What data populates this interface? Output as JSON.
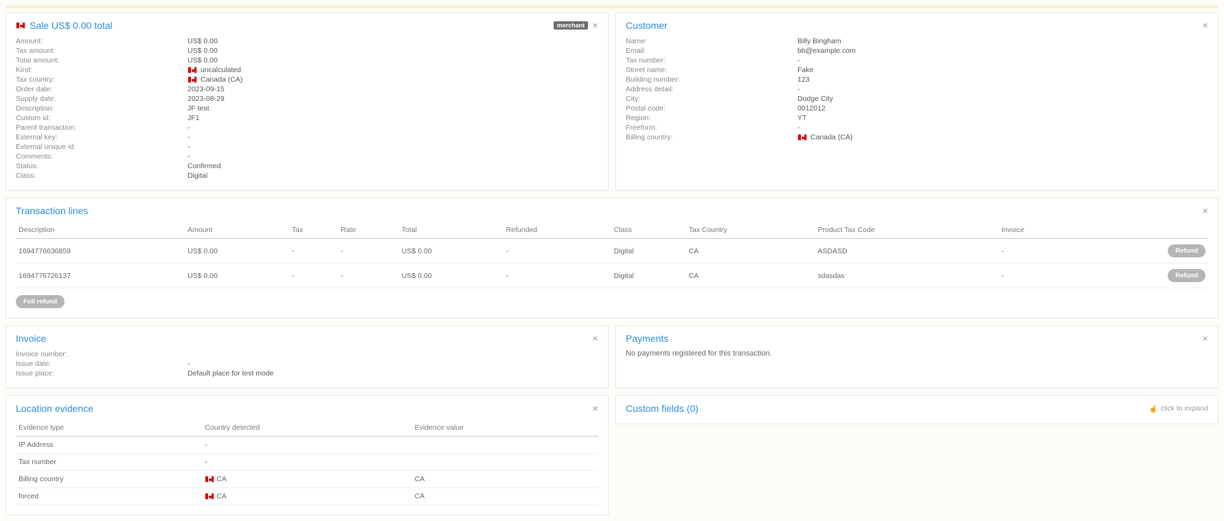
{
  "sale": {
    "title": "Sale US$ 0.00 total",
    "badge": "merchant",
    "rows": {
      "amount": {
        "label": "Amount:",
        "value": "US$ 0.00"
      },
      "tax_amount": {
        "label": "Tax amount:",
        "value": "US$ 0.00"
      },
      "total_amount": {
        "label": "Total amount:",
        "value": "US$ 0.00"
      },
      "kind": {
        "label": "Kind:",
        "value": "uncalculated",
        "flag": "ca"
      },
      "tax_country": {
        "label": "Tax country:",
        "value": "Canada (CA)",
        "flag": "ca"
      },
      "order_date": {
        "label": "Order date:",
        "value": "2023-09-15"
      },
      "supply_date": {
        "label": "Supply date:",
        "value": "2023-08-29"
      },
      "description": {
        "label": "Description:",
        "value": "JF test"
      },
      "custom_id": {
        "label": "Custom id:",
        "value": "JF1"
      },
      "parent_transaction": {
        "label": "Parent transaction:",
        "value": "-"
      },
      "external_key": {
        "label": "External key:",
        "value": "-"
      },
      "external_unique_id": {
        "label": "External unique id:",
        "value": "-"
      },
      "comments": {
        "label": "Comments:",
        "value": "-"
      },
      "status": {
        "label": "Status:",
        "value": "Confirmed"
      },
      "class": {
        "label": "Class:",
        "value": "Digital"
      }
    }
  },
  "customer": {
    "title": "Customer",
    "rows": {
      "name": {
        "label": "Name:",
        "value": "Billy Bingham"
      },
      "email": {
        "label": "Email:",
        "value": "bb@example.com"
      },
      "tax_number": {
        "label": "Tax number:",
        "value": "-"
      },
      "street_name": {
        "label": "Street name:",
        "value": "Fake"
      },
      "building_number": {
        "label": "Building number:",
        "value": "123"
      },
      "address_detail": {
        "label": "Address detail:",
        "value": "-"
      },
      "city": {
        "label": "City:",
        "value": "Dodge City"
      },
      "postal_code": {
        "label": "Postal code:",
        "value": "0012012"
      },
      "region": {
        "label": "Region:",
        "value": "YT"
      },
      "freeform": {
        "label": "Freeform:",
        "value": "-"
      },
      "billing_country": {
        "label": "Billing country:",
        "value": "Canada (CA)",
        "flag": "ca"
      }
    }
  },
  "lines": {
    "title": "Transaction lines",
    "headers": {
      "description": "Description",
      "amount": "Amount",
      "tax": "Tax",
      "rate": "Rate",
      "total": "Total",
      "refunded": "Refunded",
      "class": "Class",
      "tax_country": "Tax Country",
      "product_tax_code": "Product Tax Code",
      "invoice": "Invoice"
    },
    "rows": [
      {
        "description": "1694776636859",
        "amount": "US$ 0.00",
        "tax": "-",
        "rate": "-",
        "total": "US$ 0.00",
        "refunded": "-",
        "class": "Digital",
        "tax_country": "CA",
        "product_tax_code": "ASDASD",
        "invoice": "-",
        "action": "Refund"
      },
      {
        "description": "1694776726137",
        "amount": "US$ 0.00",
        "tax": "-",
        "rate": "-",
        "total": "US$ 0.00",
        "refunded": "-",
        "class": "Digital",
        "tax_country": "CA",
        "product_tax_code": "sdasdas",
        "invoice": "-",
        "action": "Refund"
      }
    ],
    "full_refund": "Full refund"
  },
  "invoice": {
    "title": "Invoice",
    "rows": {
      "number": {
        "label": "Invoice number:",
        "value": ""
      },
      "date": {
        "label": "Issue date:",
        "value": "-"
      },
      "place": {
        "label": "Issue place:",
        "value": "Default place for test mode"
      }
    }
  },
  "payments": {
    "title": "Payments",
    "empty": "No payments registered for this transaction."
  },
  "evidence": {
    "title": "Location evidence",
    "headers": {
      "type": "Evidence type",
      "country": "Country detected",
      "value": "Evidence value"
    },
    "rows": [
      {
        "type": "IP Address",
        "country": "-",
        "value": ""
      },
      {
        "type": "Tax number",
        "country": "-",
        "value": ""
      },
      {
        "type": "Billing country",
        "country": "CA",
        "value": "CA",
        "flag": "ca"
      },
      {
        "type": "forced",
        "country": "CA",
        "value": "CA",
        "flag": "ca"
      }
    ]
  },
  "custom_fields": {
    "title": "Custom fields (0)",
    "hint": "click to expand"
  }
}
